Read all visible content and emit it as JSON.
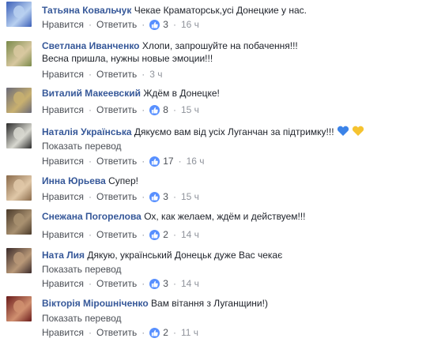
{
  "comments": [
    {
      "author": "Татьяна Ковальчук",
      "text_lines": [
        "Чекае Краматорськ,усі Донецкие у нас."
      ],
      "show_translate": false,
      "like_label": "Нравится",
      "reply_label": "Ответить",
      "likes": "3",
      "time": "16 ч",
      "avatar_colors": [
        "#3b5fb8",
        "#b8d0f0"
      ]
    },
    {
      "author": "Светлана Иванченко",
      "text_lines": [
        "Хлопи, запрошуйте на побачення!!!",
        "Весна пришла, нужны новые эмоции!!!"
      ],
      "show_translate": false,
      "like_label": "Нравится",
      "reply_label": "Ответить",
      "likes": "",
      "time": "3 ч",
      "avatar_colors": [
        "#7a8a4a",
        "#d8c8a0"
      ]
    },
    {
      "author": "Виталий Макеевский",
      "text_lines": [
        "Ждём в Донецке!"
      ],
      "show_translate": false,
      "like_label": "Нравится",
      "reply_label": "Ответить",
      "likes": "8",
      "time": "15 ч",
      "avatar_colors": [
        "#6a6a78",
        "#c8b070"
      ]
    },
    {
      "author": "Наталія Українська",
      "text_lines": [
        "Дякуємо вам від усіх Луганчан за підтримку!!!"
      ],
      "show_translate": true,
      "translate_label": "Показать перевод",
      "like_label": "Нравится",
      "reply_label": "Ответить",
      "likes": "17",
      "time": "16 ч",
      "avatar_colors": [
        "#2a2a2a",
        "#d8d8d0"
      ]
    },
    {
      "author": "Инна Юрьева",
      "text_lines": [
        "Супер!"
      ],
      "show_translate": false,
      "like_label": "Нравится",
      "reply_label": "Ответить",
      "likes": "3",
      "time": "15 ч",
      "avatar_colors": [
        "#8a6a4a",
        "#e0c8a8"
      ]
    },
    {
      "author": "Снежана Погорелова",
      "text_lines": [
        "Ох, как желаем, ждём и действуем!!!"
      ],
      "show_translate": false,
      "like_label": "Нравится",
      "reply_label": "Ответить",
      "likes": "2",
      "time": "14 ч",
      "avatar_colors": [
        "#4a3a2a",
        "#a89070"
      ]
    },
    {
      "author": "Ната Лия",
      "text_lines": [
        "Дякую, український Донецьк дуже Вас чекає"
      ],
      "show_translate": true,
      "translate_label": "Показать перевод",
      "like_label": "Нравится",
      "reply_label": "Ответить",
      "likes": "3",
      "time": "14 ч",
      "avatar_colors": [
        "#3a2a2a",
        "#b89878"
      ]
    },
    {
      "author": "Вікторія Мірошніченко",
      "text_lines": [
        "Вам вітання з Луганщини!)"
      ],
      "show_translate": true,
      "translate_label": "Показать перевод",
      "like_label": "Нравится",
      "reply_label": "Ответить",
      "likes": "2",
      "time": "11 ч",
      "avatar_colors": [
        "#6a1a1a",
        "#d09070"
      ]
    }
  ],
  "colors": {
    "author": "#365899",
    "like_badge": "#5890ff",
    "heart_blue": "#3b83e8",
    "heart_yellow": "#f5c330"
  },
  "icons": {
    "like": "thumbs-up-icon",
    "heart_blue": "blue-heart-icon",
    "heart_yellow": "yellow-heart-icon"
  }
}
